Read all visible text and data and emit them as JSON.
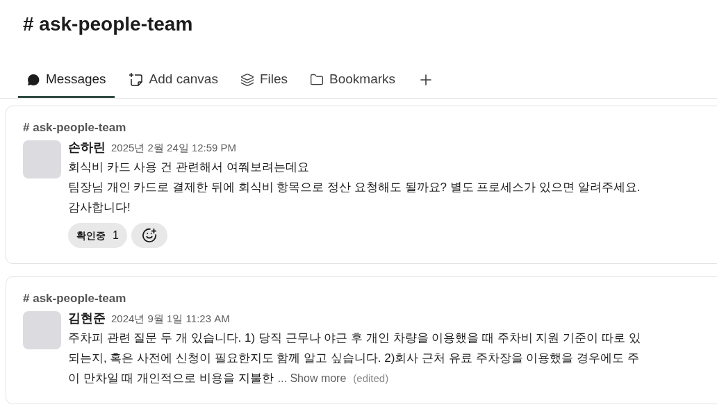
{
  "channel": {
    "title": "# ask-people-team"
  },
  "tabs": [
    {
      "kind": "messages",
      "label": "Messages",
      "selected": true
    },
    {
      "kind": "canvas",
      "label": "Add canvas",
      "selected": false
    },
    {
      "kind": "files",
      "label": "Files",
      "selected": false
    },
    {
      "kind": "bookmarks",
      "label": "Bookmarks",
      "selected": false
    },
    {
      "kind": "add",
      "selected": false
    }
  ],
  "results": [
    {
      "channel": "# ask-people-team",
      "author": "손하린",
      "time": "2025년 2월 24일 12:59 PM",
      "lines": [
        "회식비 카드 사용 건 관련해서 여쭤보려는데요",
        "팀장님 개인 카드로 결제한 뒤에 회식비 항목으로 정산 요청해도 될까요? 별도 프로세스가 있으면 알려주세요.",
        "감사합니다!"
      ],
      "reactions": [
        {
          "emoji": "확인중",
          "count": "1"
        }
      ]
    },
    {
      "channel": "# ask-people-team",
      "author": "김현준",
      "time": "2024년 9월 1일 11:23 AM",
      "lines": [
        "주차피 관련 질문 두 개 있습니다. 1) 당직 근무나 야근 후 개인 차량을 이용했을 때 주차비 지원 기준이 따로 있",
        "되는지, 혹은 사전에 신청이 필요한지도 함께 알고 싶습니다. 2)회사 근처 유료 주차장을 이용했을 경우에도 주",
        "이 만차일 때 개인적으로 비용을 지불한"
      ],
      "show_more": "... Show more",
      "edited": "(edited)"
    }
  ]
}
